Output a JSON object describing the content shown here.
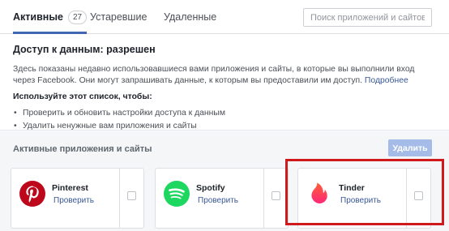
{
  "tabs": {
    "active_label": "Активные",
    "active_count": "27",
    "expired_label": "Устаревшие",
    "removed_label": "Удаленные"
  },
  "search": {
    "placeholder": "Поиск приложений и сайтов",
    "value": ""
  },
  "info": {
    "title": "Доступ к данным: разрешен",
    "description": "Здесь показаны недавно использовавшиеся вами приложения и сайты, в которые вы выполнили вход через Facebook. Они могут запрашивать данные, к которым вы предоставили им доступ.",
    "more_link": "Подробнее",
    "use_title": "Используйте этот список, чтобы:",
    "bullets": [
      "Проверить и обновить настройки доступа к данным",
      "Удалить ненужные вам приложения и сайты"
    ]
  },
  "apps_section": {
    "title": "Активные приложения и сайты",
    "delete_label": "Удалить",
    "apps": [
      {
        "name": "Pinterest",
        "action": "Проверить",
        "icon": "pinterest-logo",
        "color": "#bd081c",
        "checked": false
      },
      {
        "name": "Spotify",
        "action": "Проверить",
        "icon": "spotify-logo",
        "color": "#1ed760",
        "checked": false
      },
      {
        "name": "Tinder",
        "action": "Проверить",
        "icon": "tinder-flame-logo",
        "color": "#fd5068",
        "checked": false
      }
    ]
  },
  "colors": {
    "accent": "#4267b2",
    "link": "#385898",
    "highlight": "#d0191b",
    "delete_disabled": "#a5bce8"
  }
}
